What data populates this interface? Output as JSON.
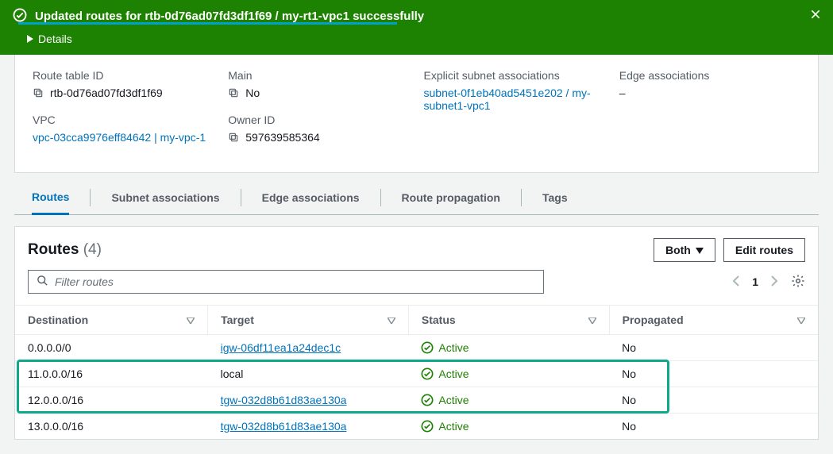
{
  "banner": {
    "title": "Updated routes for rtb-0d76ad07fd3df1f69 / my-rt1-vpc1 successfully",
    "details": "Details"
  },
  "info": {
    "route_table_id_label": "Route table ID",
    "route_table_id": "rtb-0d76ad07fd3df1f69",
    "vpc_label": "VPC",
    "vpc": "vpc-03cca9976eff84642 | my-vpc-1",
    "main_label": "Main",
    "main": "No",
    "owner_id_label": "Owner ID",
    "owner_id": "597639585364",
    "explicit_label": "Explicit subnet associations",
    "explicit": "subnet-0f1eb40ad5451e202 / my-subnet1-vpc1",
    "edge_label": "Edge associations",
    "edge": "–"
  },
  "tabs": [
    "Routes",
    "Subnet associations",
    "Edge associations",
    "Route propagation",
    "Tags"
  ],
  "panel": {
    "title": "Routes",
    "count": "(4)",
    "both_label": "Both",
    "edit_label": "Edit routes",
    "filter_placeholder": "Filter routes",
    "page": "1"
  },
  "columns": {
    "destination": "Destination",
    "target": "Target",
    "status": "Status",
    "propagated": "Propagated"
  },
  "routes": [
    {
      "destination": "0.0.0.0/0",
      "target": "igw-06df11ea1a24dec1c",
      "target_link": true,
      "status": "Active",
      "propagated": "No"
    },
    {
      "destination": "11.0.0.0/16",
      "target": "local",
      "target_link": false,
      "status": "Active",
      "propagated": "No"
    },
    {
      "destination": "12.0.0.0/16",
      "target": "tgw-032d8b61d83ae130a",
      "target_link": true,
      "status": "Active",
      "propagated": "No"
    },
    {
      "destination": "13.0.0.0/16",
      "target": "tgw-032d8b61d83ae130a",
      "target_link": true,
      "status": "Active",
      "propagated": "No"
    }
  ]
}
